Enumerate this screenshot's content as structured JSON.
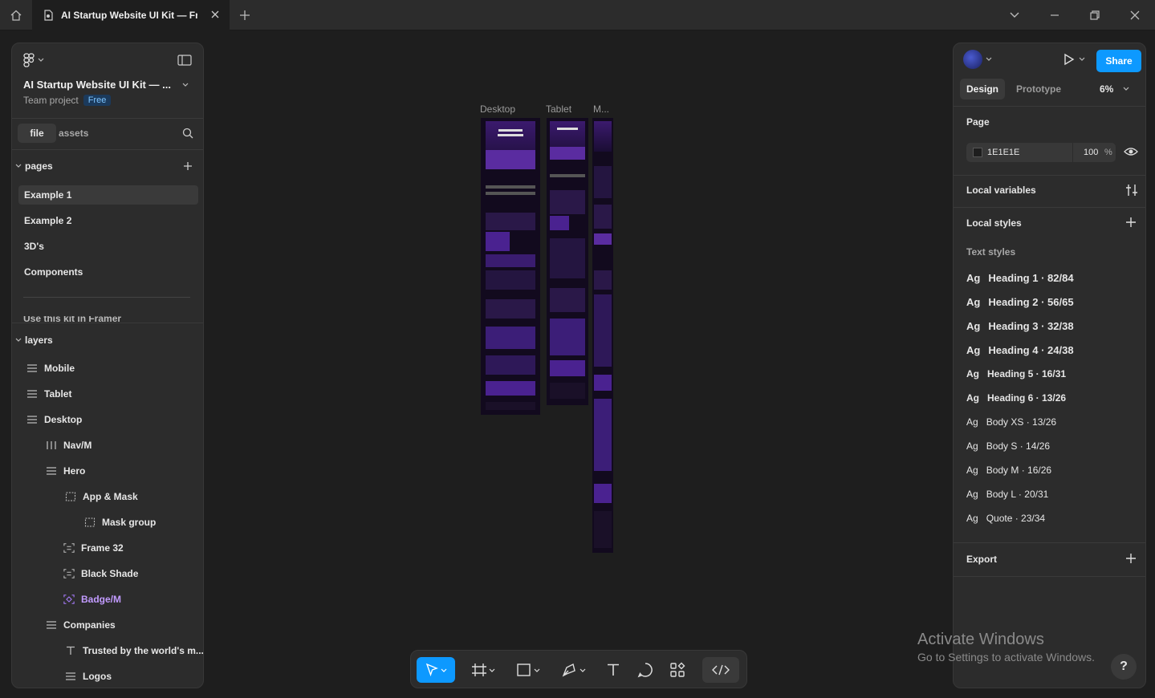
{
  "titlebar": {
    "tab_title": "AI Startup Website UI Kit — Fram",
    "icons": [
      "home-icon",
      "figma-icon",
      "close-icon",
      "plus-icon",
      "chevron-down-icon",
      "minimize-icon",
      "maximize-icon",
      "close-window-icon"
    ]
  },
  "left": {
    "file_name": "AI Startup Website UI Kit — ...",
    "team": "Team project",
    "badge": "Free",
    "tab_file": "file",
    "tab_assets": "assets",
    "pages_label": "pages",
    "pages": [
      {
        "label": "Example 1",
        "selected": true
      },
      {
        "label": "Example 2",
        "selected": false
      },
      {
        "label": "3D's",
        "selected": false
      },
      {
        "label": "Components",
        "selected": false
      }
    ],
    "pages_overflow": "Use this kit in Framer",
    "layers_label": "layers",
    "layers": [
      {
        "label": "Mobile",
        "icon": "frame-rows-icon"
      },
      {
        "label": "Tablet",
        "icon": "frame-rows-icon"
      },
      {
        "label": "Desktop",
        "icon": "frame-rows-icon"
      },
      {
        "label": "Nav/M",
        "icon": "frame-columns-icon"
      },
      {
        "label": "Hero",
        "icon": "frame-rows-icon"
      },
      {
        "label": "App & Mask",
        "icon": "dashed-frame-icon"
      },
      {
        "label": "Mask group",
        "icon": "dashed-frame-icon"
      },
      {
        "label": "Frame 32",
        "icon": "frame-rows-icon"
      },
      {
        "label": "Black Shade",
        "icon": "frame-rows-icon"
      },
      {
        "label": "Badge/M",
        "icon": "component-instance-icon"
      },
      {
        "label": "Companies",
        "icon": "frame-rows-icon"
      },
      {
        "label": "Trusted by the world's m...",
        "icon": "text-icon"
      },
      {
        "label": "Logos",
        "icon": "frame-rows-icon"
      }
    ]
  },
  "canvas": {
    "frames": [
      {
        "label": "Desktop"
      },
      {
        "label": "Tablet"
      },
      {
        "label": "M..."
      }
    ],
    "colors": {
      "bg": "#1e1e1e",
      "frame_bg": "#120a1e",
      "accent": "#7b3fe4"
    }
  },
  "toolbar": {
    "tools": [
      "move-icon",
      "frame-icon",
      "rectangle-icon",
      "pen-icon",
      "text-icon",
      "comment-icon",
      "actions-icon",
      "dev-mode-icon"
    ]
  },
  "right": {
    "share_label": "Share",
    "tab_design": "Design",
    "tab_prototype": "Prototype",
    "zoom": "6%",
    "page_label": "Page",
    "fill_hex": "1E1E1E",
    "fill_opacity": "100",
    "fill_unit": "%",
    "local_variables": "Local variables",
    "local_styles": "Local styles",
    "text_styles_label": "Text styles",
    "text_styles": [
      {
        "ag": "Ag",
        "name": "Heading 1 · 82/84"
      },
      {
        "ag": "Ag",
        "name": "Heading 2 · 56/65"
      },
      {
        "ag": "Ag",
        "name": "Heading 3 · 32/38"
      },
      {
        "ag": "Ag",
        "name": "Heading 4 · 24/38"
      },
      {
        "ag": "Ag",
        "name": "Heading 5 · 16/31"
      },
      {
        "ag": "Ag",
        "name": "Heading 6 · 13/26"
      },
      {
        "ag": "Ag",
        "name": "Body XS · 13/26"
      },
      {
        "ag": "Ag",
        "name": "Body S · 14/26"
      },
      {
        "ag": "Ag",
        "name": "Body M · 16/26"
      },
      {
        "ag": "Ag",
        "name": "Body L · 20/31"
      },
      {
        "ag": "Ag",
        "name": "Quote · 23/34"
      }
    ],
    "export_label": "Export",
    "accent": "#0d99ff"
  },
  "watermark": {
    "line1": "Activate Windows",
    "line2": "Go to Settings to activate Windows."
  },
  "help": "?"
}
